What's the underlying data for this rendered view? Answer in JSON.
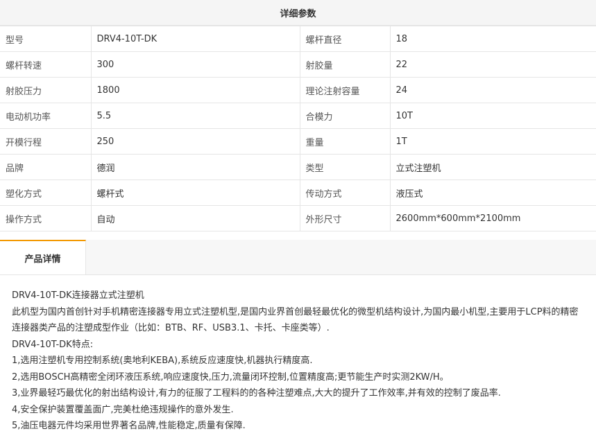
{
  "params": {
    "header": "详细参数",
    "rows": [
      [
        {
          "label": "型号",
          "value": "DRV4-10T-DK"
        },
        {
          "label": "螺杆直径",
          "value": "18"
        }
      ],
      [
        {
          "label": "螺杆转速",
          "value": "300"
        },
        {
          "label": "射胶量",
          "value": "22"
        }
      ],
      [
        {
          "label": "射胶压力",
          "value": "1800"
        },
        {
          "label": "理论注射容量",
          "value": "24"
        }
      ],
      [
        {
          "label": "电动机功率",
          "value": "5.5"
        },
        {
          "label": "合模力",
          "value": "10T"
        }
      ],
      [
        {
          "label": "开模行程",
          "value": "250"
        },
        {
          "label": "重量",
          "value": "1T"
        }
      ],
      [
        {
          "label": "品牌",
          "value": "德润"
        },
        {
          "label": "类型",
          "value": "立式注塑机"
        }
      ],
      [
        {
          "label": "塑化方式",
          "value": "螺杆式"
        },
        {
          "label": "传动方式",
          "value": "液压式"
        }
      ],
      [
        {
          "label": "操作方式",
          "value": "自动"
        },
        {
          "label": "外形尺寸",
          "value": "2600mm*600mm*2100mm"
        }
      ]
    ]
  },
  "tabs": {
    "active": "产品详情"
  },
  "detail": {
    "title": "DRV4-10T-DK连接器立式注塑机",
    "description": "此机型为国内首创针对手机精密连接器专用立式注塑机型,是国内业界首创最轻最优化的微型机结构设计,为国内最小机型,主要用于LCP料的精密连接器类产品的注塑成型作业（比如：BTB、RF、USB3.1、卡托、卡座类等）.",
    "features_title": "DRV4-10T-DK特点:",
    "features": [
      "1,选用注塑机专用控制系统(奥地利KEBA),系统反应速度快,机器执行精度高.",
      "2,选用BOSCH高精密全闭环液压系统,响应速度快,压力,流量闭环控制,位置精度高;更节能生产时实测2KW/H。",
      "3,业界最轻巧最优化的射出结构设计,有力的征服了工程料的的各种注塑难点,大大的提升了工作效率,并有效的控制了废品率.",
      "4,安全保护装置覆盖面广,完美杜绝违规操作的意外发生.",
      "5,油压电器元件均采用世界著名品牌,性能稳定,质量有保障."
    ]
  }
}
